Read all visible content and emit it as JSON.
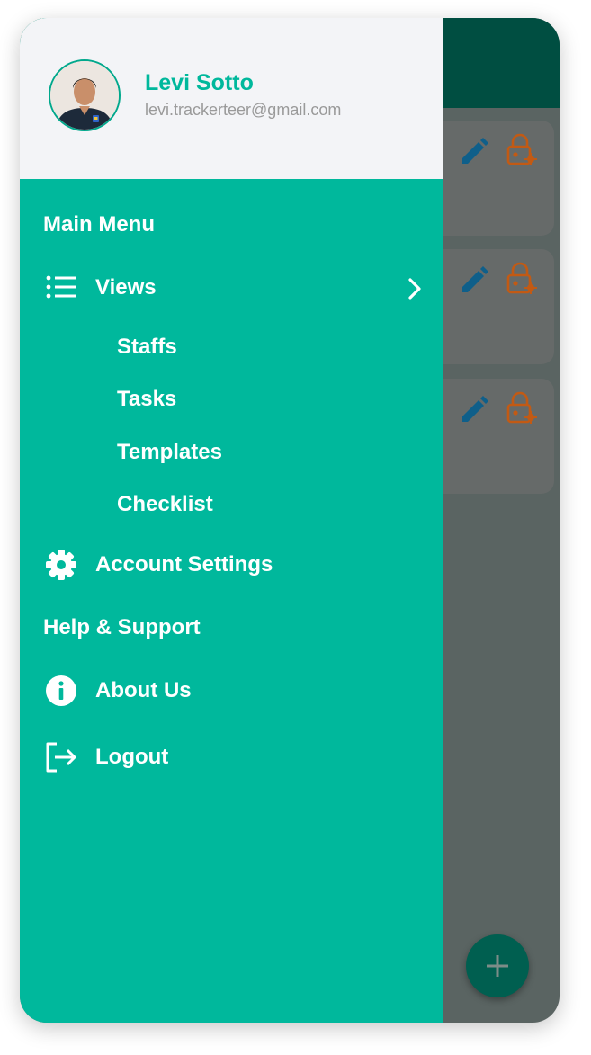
{
  "user": {
    "name": "Levi Sotto",
    "email": "levi.trackerteer@gmail.com",
    "avatar_icon": "profile-photo"
  },
  "menu": {
    "section_title": "Main Menu",
    "views": {
      "label": "Views",
      "icon": "list-icon",
      "expand_icon": "chevron-right-icon",
      "subitems": [
        "Staffs",
        "Tasks",
        "Templates",
        "Checklist"
      ]
    },
    "account_settings": {
      "label": "Account Settings",
      "icon": "gear-icon"
    },
    "help_support": {
      "label": "Help & Support"
    },
    "about_us": {
      "label": "About Us",
      "icon": "info-icon"
    },
    "logout": {
      "label": "Logout",
      "icon": "logout-icon"
    }
  },
  "background_list": {
    "cards": [
      {
        "actions": [
          "edit-icon",
          "lock-settings-icon"
        ]
      },
      {
        "actions": [
          "edit-icon",
          "lock-settings-icon"
        ]
      },
      {
        "actions": [
          "edit-icon",
          "lock-settings-icon"
        ]
      }
    ],
    "fab_icon": "plus-icon"
  },
  "colors": {
    "drawer": "#00b89c",
    "header_bg": "#f3f4f7",
    "app_bar": "#004e41",
    "overlay": "#5a6462",
    "edit_icon": "#0f5f8a",
    "lock_icon": "#c25a14",
    "fab": "#005f50"
  }
}
